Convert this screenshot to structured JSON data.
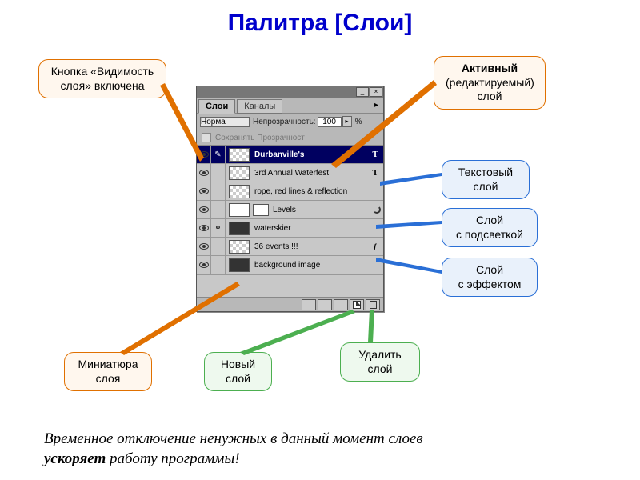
{
  "title": "Палитра [Слои]",
  "callouts": {
    "visibility": "Кнопка «Видимость слоя» включена",
    "active_l1": "Активный",
    "active_l2": "(редактируемый)",
    "active_l3": "слой",
    "text_l1": "Текстовый",
    "text_l2": "слой",
    "hilite_l1": "Слой",
    "hilite_l2": "с подсветкой",
    "effect_l1": "Слой",
    "effect_l2": "с эффектом",
    "thumb_l1": "Миниатюра",
    "thumb_l2": "слоя",
    "new_l1": "Новый",
    "new_l2": "слой",
    "delete_l1": "Удалить",
    "delete_l2": "слой"
  },
  "panel": {
    "tab_layers": "Слои",
    "tab_channels": "Каналы",
    "blend_mode": "Норма",
    "opacity_label": "Непрозрачность:",
    "opacity_value": "100",
    "opacity_pct": "%",
    "preserve_label": "Сохранять Прозрачност"
  },
  "layers": [
    {
      "name": "Durbanville's",
      "badge": "T",
      "active": true,
      "thumb": "check"
    },
    {
      "name": "3rd Annual Waterfest",
      "badge": "T",
      "active": false,
      "thumb": "check"
    },
    {
      "name": "rope, red lines & reflection",
      "badge": "",
      "active": false,
      "thumb": "check"
    },
    {
      "name": "Levels",
      "badge": "ring",
      "active": false,
      "thumb": "white",
      "extra": true
    },
    {
      "name": "waterskier",
      "badge": "",
      "active": false,
      "thumb": "dark",
      "linked": true
    },
    {
      "name": "36 events !!!",
      "badge": "fx",
      "active": false,
      "thumb": "check"
    },
    {
      "name": "background image",
      "badge": "",
      "active": false,
      "thumb": "dark"
    }
  ],
  "footer_note_1": "Временное отключение ненужных в данный момент слоев ",
  "footer_note_2a": "ускоряет",
  "footer_note_2b": " работу программы!"
}
